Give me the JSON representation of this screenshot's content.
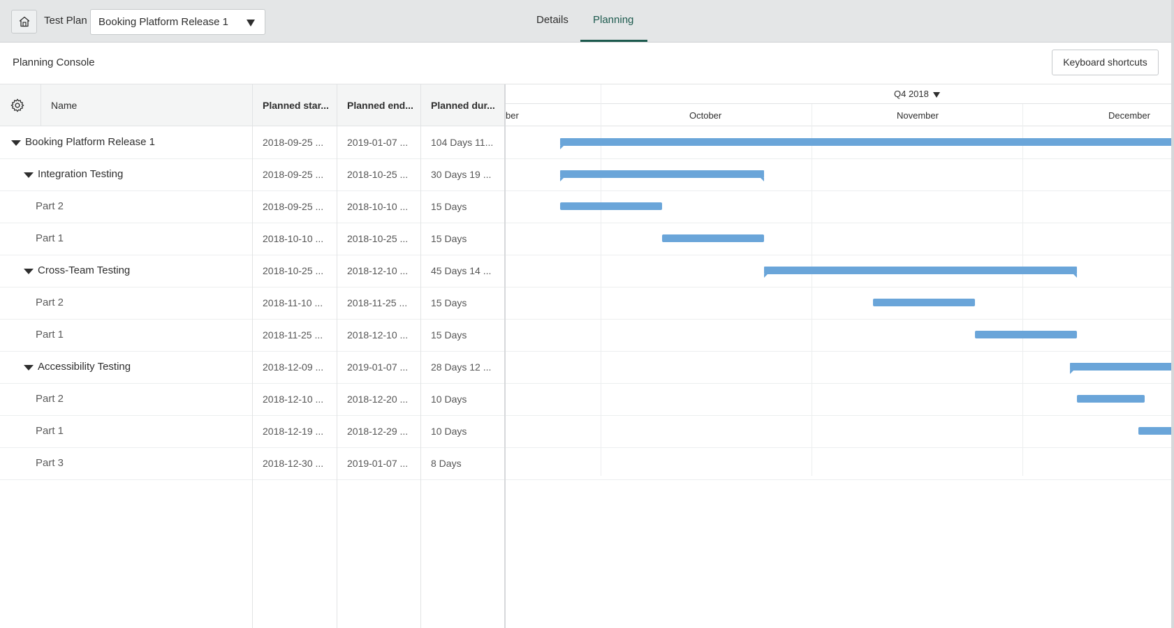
{
  "header": {
    "test_plan_label": "Test Plan",
    "test_plan_value": "Booking Platform Release 1",
    "tabs": [
      {
        "label": "Details",
        "active": false
      },
      {
        "label": "Planning",
        "active": true
      }
    ]
  },
  "console": {
    "title": "Planning Console",
    "keyboard_shortcuts_label": "Keyboard shortcuts"
  },
  "grid": {
    "columns": [
      "Name",
      "Planned star...",
      "Planned end...",
      "Planned dur..."
    ],
    "rows": [
      {
        "name": "Booking Platform Release 1",
        "level": 0,
        "expanded": true,
        "start": "2018-09-25 ...",
        "end": "2019-01-07 ...",
        "duration": "104 Days 11..."
      },
      {
        "name": "Integration Testing",
        "level": 1,
        "expanded": true,
        "start": "2018-09-25 ...",
        "end": "2018-10-25 ...",
        "duration": "30 Days 19 ..."
      },
      {
        "name": "Part 2",
        "level": 2,
        "start": "2018-09-25 ...",
        "end": "2018-10-10 ...",
        "duration": "15 Days"
      },
      {
        "name": "Part 1",
        "level": 2,
        "start": "2018-10-10 ...",
        "end": "2018-10-25 ...",
        "duration": "15 Days"
      },
      {
        "name": "Cross-Team Testing",
        "level": 1,
        "expanded": true,
        "start": "2018-10-25 ...",
        "end": "2018-12-10 ...",
        "duration": "45 Days 14 ..."
      },
      {
        "name": "Part 2",
        "level": 2,
        "start": "2018-11-10 ...",
        "end": "2018-11-25 ...",
        "duration": "15 Days"
      },
      {
        "name": "Part 1",
        "level": 2,
        "start": "2018-11-25 ...",
        "end": "2018-12-10 ...",
        "duration": "15 Days"
      },
      {
        "name": "Accessibility Testing",
        "level": 1,
        "expanded": true,
        "start": "2018-12-09 ...",
        "end": "2019-01-07 ...",
        "duration": "28 Days 12 ..."
      },
      {
        "name": "Part 2",
        "level": 2,
        "start": "2018-12-10 ...",
        "end": "2018-12-20 ...",
        "duration": "10 Days"
      },
      {
        "name": "Part 1",
        "level": 2,
        "start": "2018-12-19 ...",
        "end": "2018-12-29 ...",
        "duration": "10 Days"
      },
      {
        "name": "Part 3",
        "level": 2,
        "start": "2018-12-30 ...",
        "end": "2019-01-07 ...",
        "duration": "8 Days"
      }
    ]
  },
  "gantt": {
    "quarter_label": "Q4 2018",
    "months": [
      "ber",
      "October",
      "November",
      "December"
    ],
    "bar_color": "#6aa5d9",
    "accent_color": "#1d5a4e"
  },
  "icons": {
    "home": "home-icon",
    "dropdown": "caret-down-icon",
    "settings": "gear-icon",
    "expand": "triangle-down-icon"
  }
}
